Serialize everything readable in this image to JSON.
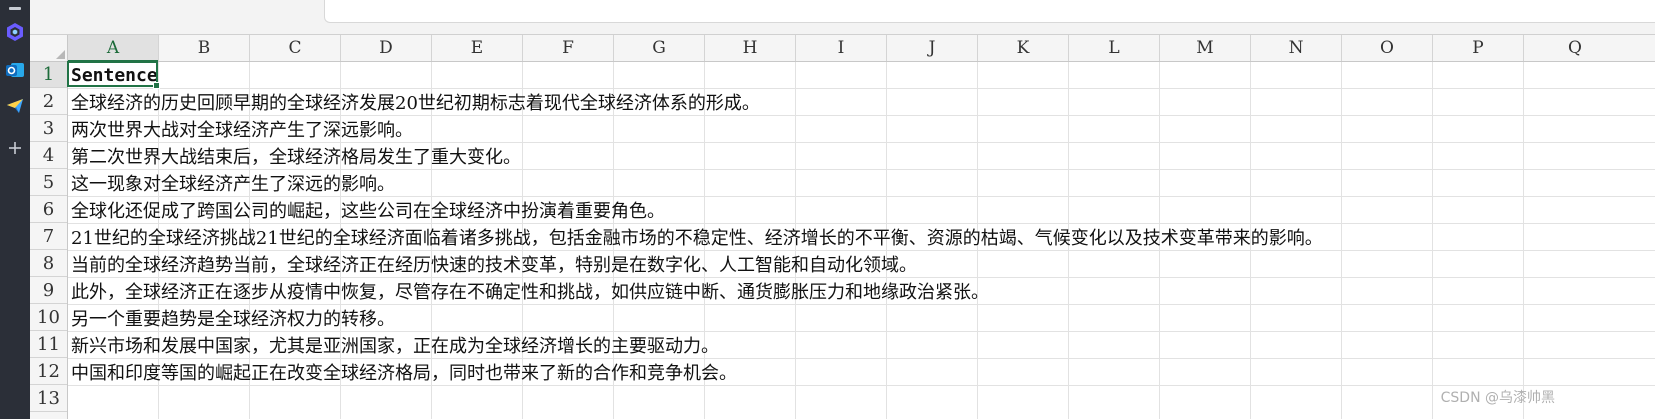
{
  "sheet": {
    "columns": [
      "A",
      "B",
      "C",
      "D",
      "E",
      "F",
      "G",
      "H",
      "I",
      "J",
      "K",
      "L",
      "M",
      "N",
      "O",
      "P",
      "Q"
    ],
    "active_column": "A",
    "rows": [
      "1",
      "2",
      "3",
      "4",
      "5",
      "6",
      "7",
      "8",
      "9",
      "10",
      "11",
      "12",
      "13"
    ],
    "active_row": "1",
    "cells": [
      "Sentence",
      "全球经济的历史回顾早期的全球经济发展20世纪初期标志着现代全球经济体系的形成。",
      "两次世界大战对全球经济产生了深远影响。",
      "第二次世界大战结束后，全球经济格局发生了重大变化。",
      "这一现象对全球经济产生了深远的影响。",
      "全球化还促成了跨国公司的崛起，这些公司在全球经济中扮演着重要角色。",
      "21世纪的全球经济挑战21世纪的全球经济面临着诸多挑战，包括金融市场的不稳定性、经济增长的不平衡、资源的枯竭、气候变化以及技术变革带来的影响。",
      "当前的全球经济趋势当前，全球经济正在经历快速的技术变革，特别是在数字化、人工智能和自动化领域。",
      "此外，全球经济正在逐步从疫情中恢复，尽管存在不确定性和挑战，如供应链中断、通货膨胀压力和地缘政治紧张。",
      "另一个重要趋势是全球经济权力的转移。",
      "新兴市场和发展中国家，尤其是亚洲国家，正在成为全球经济增长的主要驱动力。",
      "中国和印度等国的崛起正在改变全球经济格局，同时也带来了新的合作和竞争机会。"
    ]
  },
  "watermark": "CSDN @乌漆帅黑",
  "colors": {
    "selection": "#217346",
    "rail": "#2b2f38"
  }
}
